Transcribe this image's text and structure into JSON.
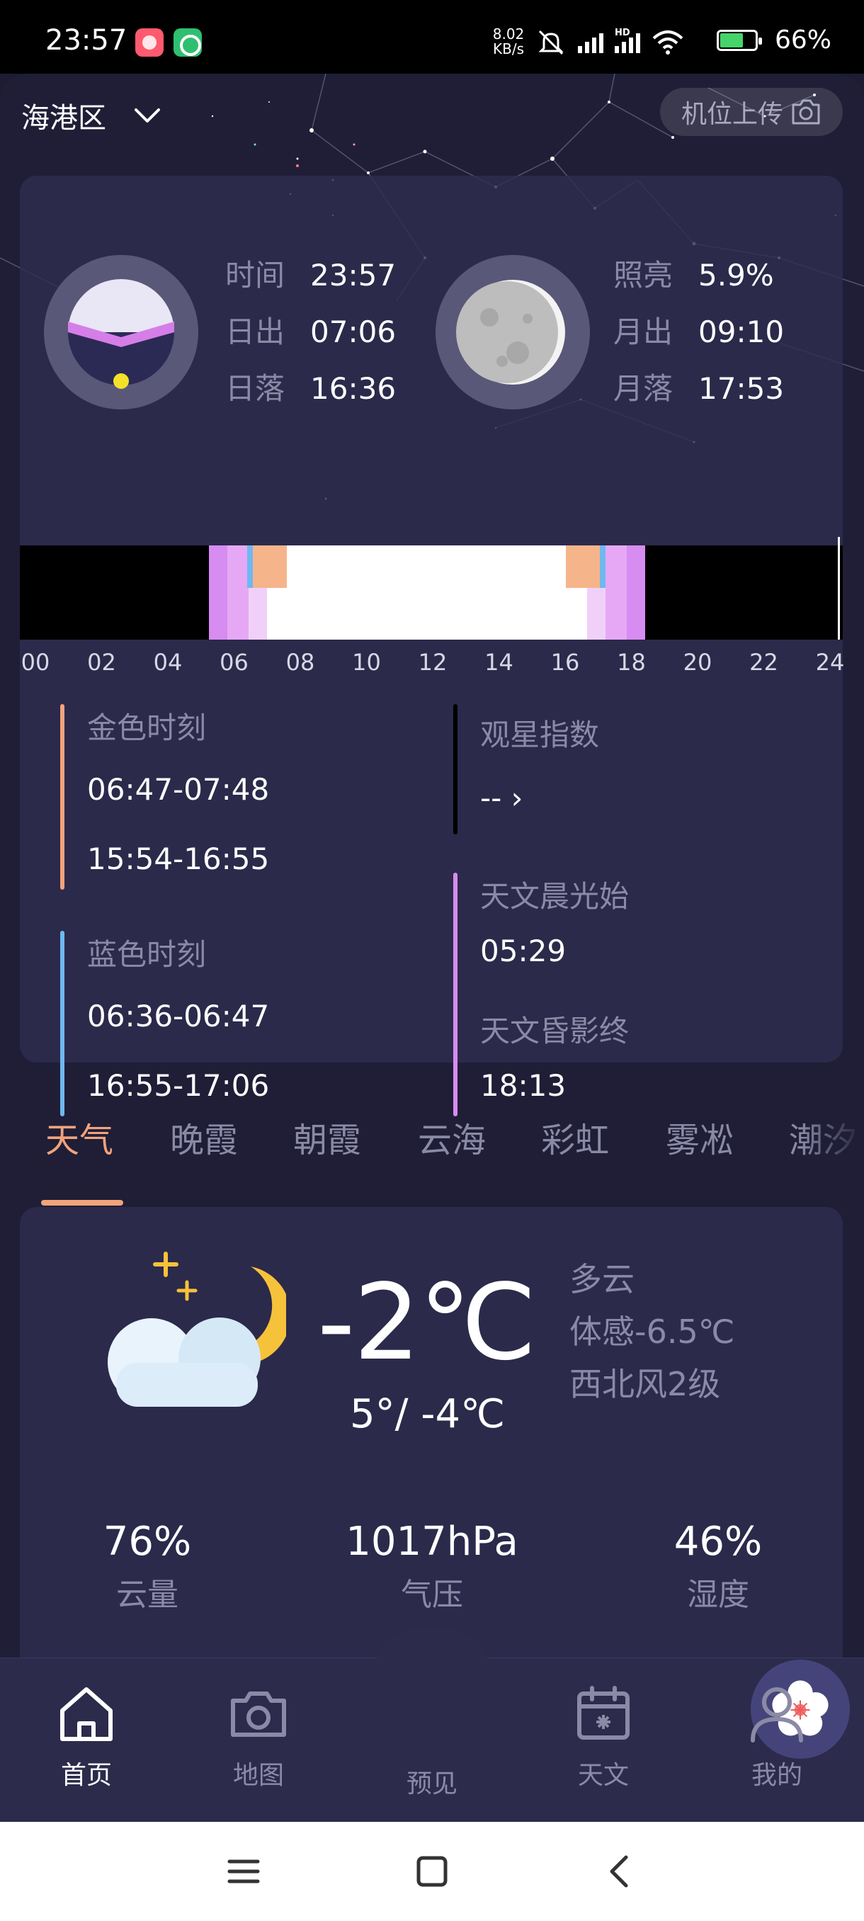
{
  "status_bar": {
    "time": "23:57",
    "net_speed_value": "8.02",
    "net_speed_unit": "KB/s",
    "battery_percent": "66%"
  },
  "header": {
    "location": "海港区",
    "upload_label": "机位上传"
  },
  "astro": {
    "sun": [
      {
        "label": "时间",
        "value": "23:57"
      },
      {
        "label": "日出",
        "value": "07:06"
      },
      {
        "label": "日落",
        "value": "16:36"
      }
    ],
    "moon": [
      {
        "label": "照亮",
        "value": "5.9%"
      },
      {
        "label": "月出",
        "value": "09:10"
      },
      {
        "label": "月落",
        "value": "17:53"
      }
    ],
    "timeline_ticks": [
      "00",
      "02",
      "04",
      "06",
      "08",
      "10",
      "12",
      "14",
      "16",
      "18",
      "20",
      "22",
      "24"
    ],
    "golden_hour": {
      "title": "金色时刻",
      "morning": "06:47-07:48",
      "evening": "15:54-16:55"
    },
    "blue_hour": {
      "title": "蓝色时刻",
      "morning": "06:36-06:47",
      "evening": "16:55-17:06"
    },
    "stargazing": {
      "title": "观星指数",
      "value": "-- ›"
    },
    "astro_dawn": {
      "title": "天文晨光始",
      "value": "05:29"
    },
    "astro_dusk": {
      "title": "天文昏影终",
      "value": "18:13"
    }
  },
  "tabs": [
    "天气",
    "晚霞",
    "朝霞",
    "云海",
    "彩虹",
    "雾凇",
    "潮汐"
  ],
  "weather": {
    "temperature": "-2℃",
    "range": "5°/ -4℃",
    "condition": "多云",
    "feels_like": "体感-6.5℃",
    "wind": "西北风2级",
    "stats": [
      {
        "value": "76%",
        "label": "云量"
      },
      {
        "value": "1017hPa",
        "label": "气压"
      },
      {
        "value": "46%",
        "label": "湿度"
      }
    ]
  },
  "bottom_nav": [
    {
      "label": "首页",
      "icon": "home-icon"
    },
    {
      "label": "地图",
      "icon": "camera-icon"
    },
    {
      "label": "预见",
      "icon": "flower-icon"
    },
    {
      "label": "天文",
      "icon": "calendar-icon"
    },
    {
      "label": "我的",
      "icon": "user-icon"
    }
  ],
  "colors": {
    "accent": "#f2a37c",
    "golden": "#f2a37c",
    "blue": "#6fb8f0",
    "astro": "#d68cf0",
    "background": "#1f1e36",
    "card": "#2b2a4b"
  }
}
